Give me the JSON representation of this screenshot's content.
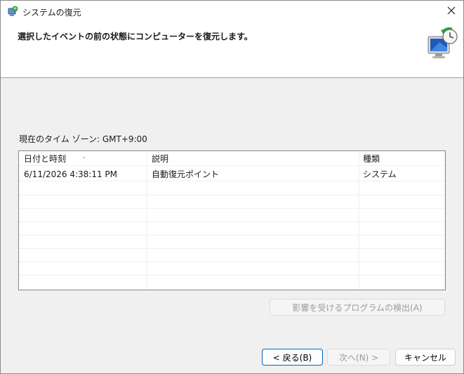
{
  "window": {
    "title": "システムの復元"
  },
  "header": {
    "instruction": "選択したイベントの前の状態にコンピューターを復元します。"
  },
  "timezone_label": "現在のタイム ゾーン: GMT+9:00",
  "table": {
    "columns": [
      "日付と時刻",
      "説明",
      "種類"
    ],
    "rows": [
      [
        "6/11/2026 4:38:11 PM",
        "自動復元ポイント",
        "システム"
      ]
    ]
  },
  "buttons": {
    "scan_affected": "影響を受けるプログラムの検出(A)",
    "back": "< 戻る(B)",
    "next": "次へ(N) >",
    "cancel": "キャンセル"
  },
  "colors": {
    "accent": "#0067c0",
    "window_bg": "#f0f0f0",
    "disabled_text": "#9a9a9a"
  }
}
